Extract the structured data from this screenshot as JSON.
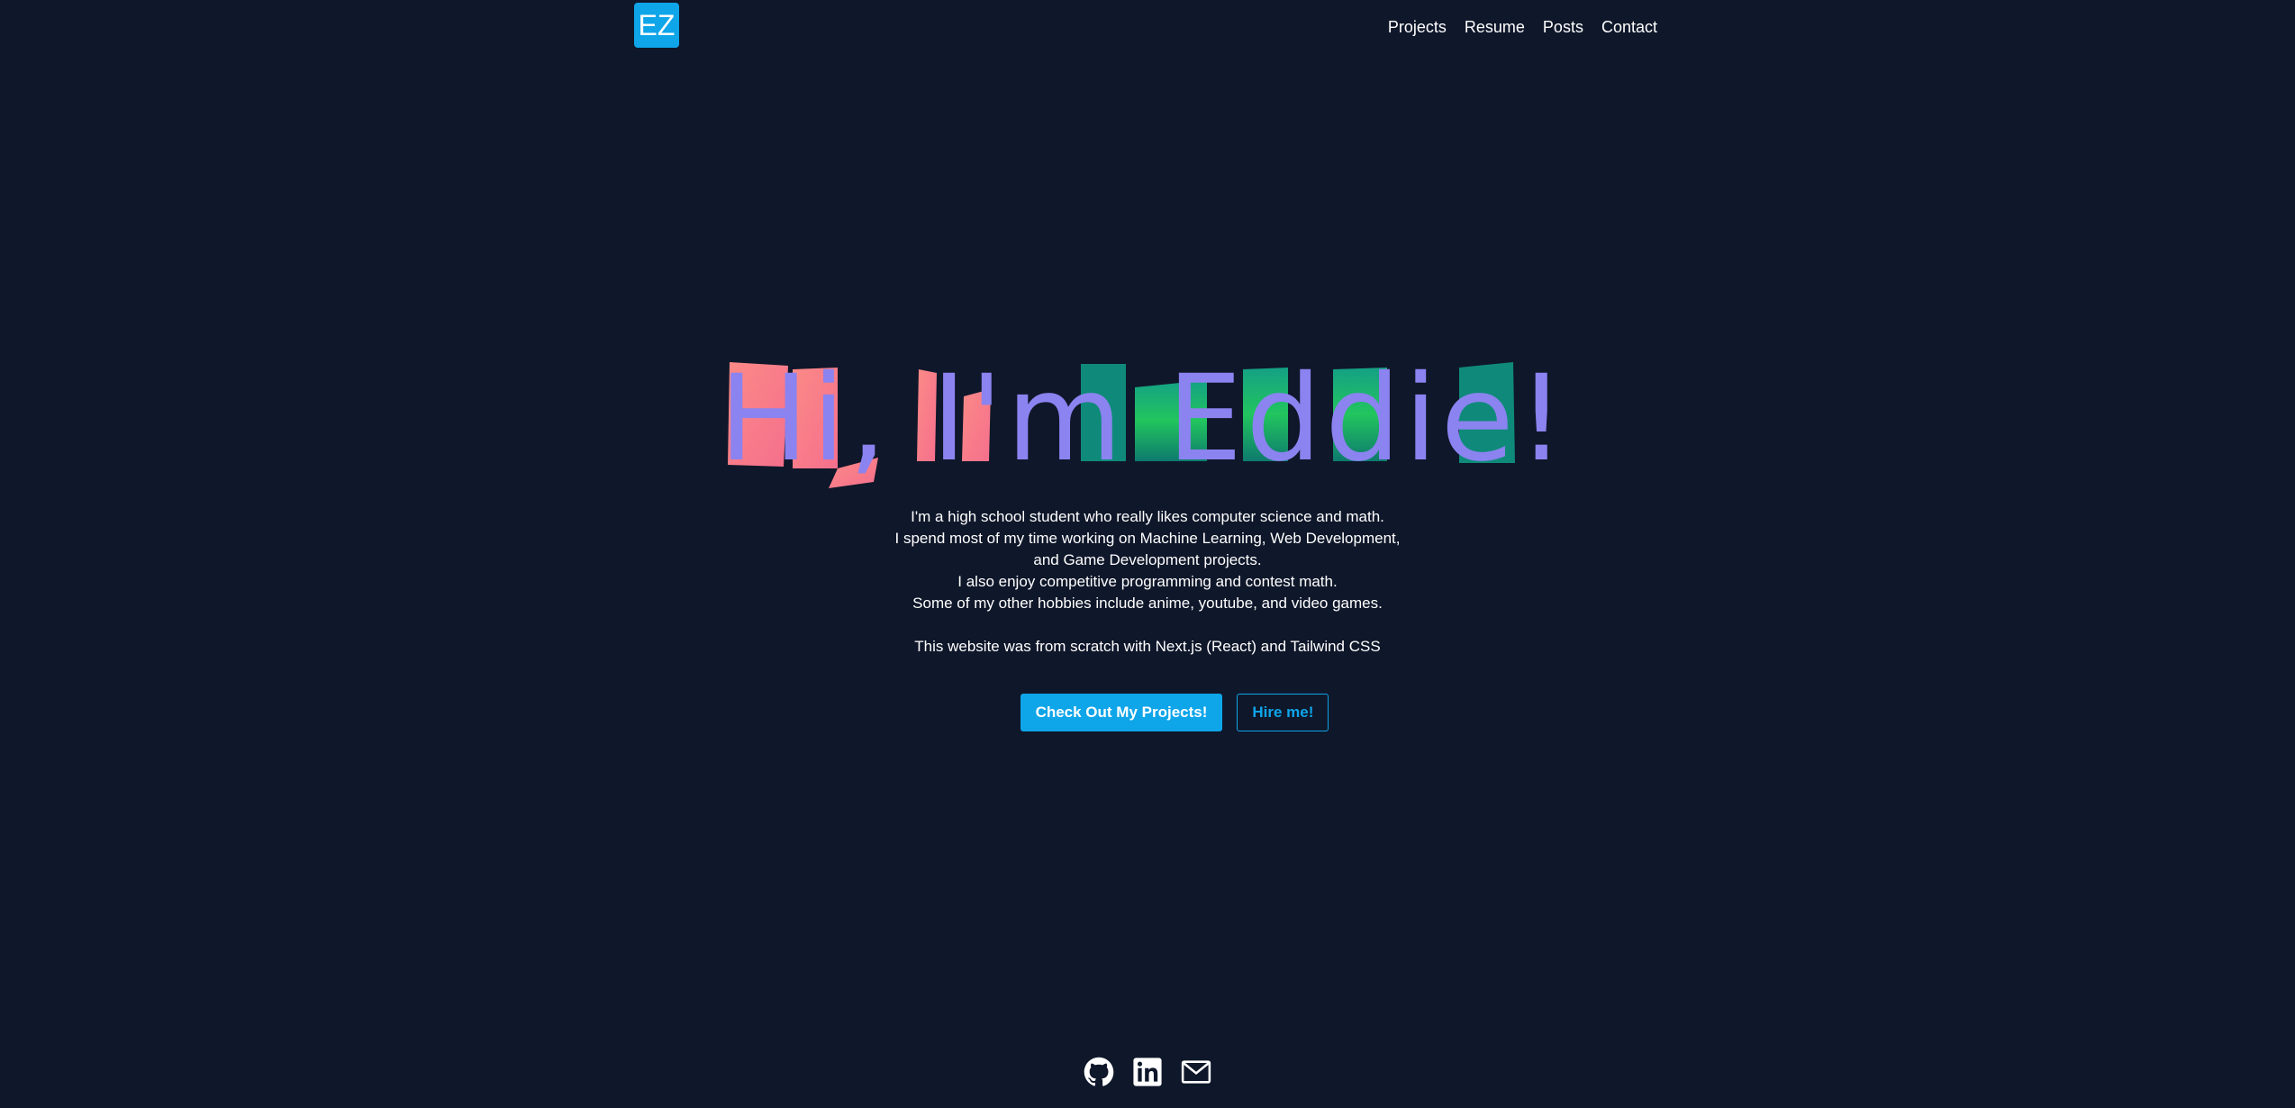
{
  "header": {
    "logo_text": "EZ",
    "nav": [
      {
        "label": "Projects"
      },
      {
        "label": "Resume"
      },
      {
        "label": "Posts"
      },
      {
        "label": "Contact"
      }
    ]
  },
  "hero": {
    "title": "Hi, I'm Eddie!",
    "lines": [
      "I'm a high school student who really likes computer science and math.",
      "I spend most of my time working on Machine Learning, Web Development,",
      "and Game Development projects.",
      "I also enjoy competitive programming and contest math.",
      "Some of my other hobbies include anime, youtube, and video games.",
      "This website was from scratch with Next.js (React) and Tailwind CSS"
    ],
    "primary_button": "Check Out My Projects!",
    "secondary_button": "Hire me!"
  },
  "footer": {
    "socials": [
      {
        "icon": "github-icon"
      },
      {
        "icon": "linkedin-icon"
      },
      {
        "icon": "mail-icon"
      }
    ]
  },
  "colors": {
    "background": "#0f172a",
    "accent": "#0ea5e9",
    "title_face": "#8b83f0",
    "title_side_pink": "#fb7f84",
    "title_side_teal": "#0f8a7a"
  }
}
